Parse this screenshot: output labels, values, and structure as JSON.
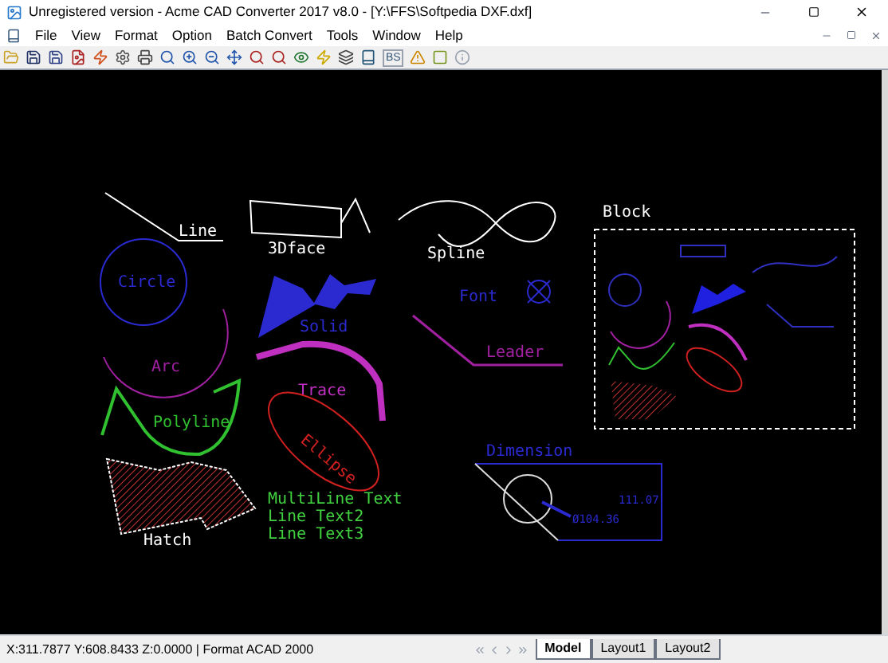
{
  "window": {
    "title": "Unregistered version - Acme CAD Converter 2017 v8.0 - [Y:\\FFS\\Softpedia DXF.dxf]"
  },
  "menu": [
    "File",
    "View",
    "Format",
    "Option",
    "Batch Convert",
    "Tools",
    "Window",
    "Help"
  ],
  "toolbar": {
    "text_button": "BS"
  },
  "drawing": {
    "labels": [
      {
        "kind": "line",
        "text": "Line",
        "color": "#ffffff"
      },
      {
        "kind": "face",
        "text": "3Dface",
        "color": "#ffffff"
      },
      {
        "kind": "spline",
        "text": "Spline",
        "color": "#ffffff"
      },
      {
        "kind": "circle",
        "text": "Circle",
        "color": "#2a2ad0"
      },
      {
        "kind": "solid",
        "text": "Solid",
        "color": "#2a2ad0"
      },
      {
        "kind": "font",
        "text": "Font",
        "color": "#2a2ad0"
      },
      {
        "kind": "arc",
        "text": "Arc",
        "color": "#a020a0"
      },
      {
        "kind": "leader",
        "text": "Leader",
        "color": "#a020a0"
      },
      {
        "kind": "trace",
        "text": "Trace",
        "color": "#c030c0"
      },
      {
        "kind": "polyline",
        "text": "Polyline",
        "color": "#30c030"
      },
      {
        "kind": "ellipse",
        "text": "Ellipse",
        "color": "#d02020"
      },
      {
        "kind": "hatch",
        "text": "Hatch",
        "color": "#ffffff"
      },
      {
        "kind": "block",
        "text": "Block",
        "color": "#ffffff"
      },
      {
        "kind": "dimension",
        "text": "Dimension",
        "color": "#2a2ad0"
      }
    ],
    "multiline_text": [
      "MultiLine Text",
      "Line Text2",
      "Line Text3"
    ],
    "dimension_values": [
      "Ø104.36",
      "111.07"
    ]
  },
  "status_bar": {
    "coordinates": "X:311.7877 Y:608.8433 Z:0.0000 | Format ACAD 2000"
  },
  "layout_tabs": [
    {
      "label": "Model",
      "selected": true
    },
    {
      "label": "Layout1",
      "selected": false
    },
    {
      "label": "Layout2",
      "selected": false
    }
  ]
}
